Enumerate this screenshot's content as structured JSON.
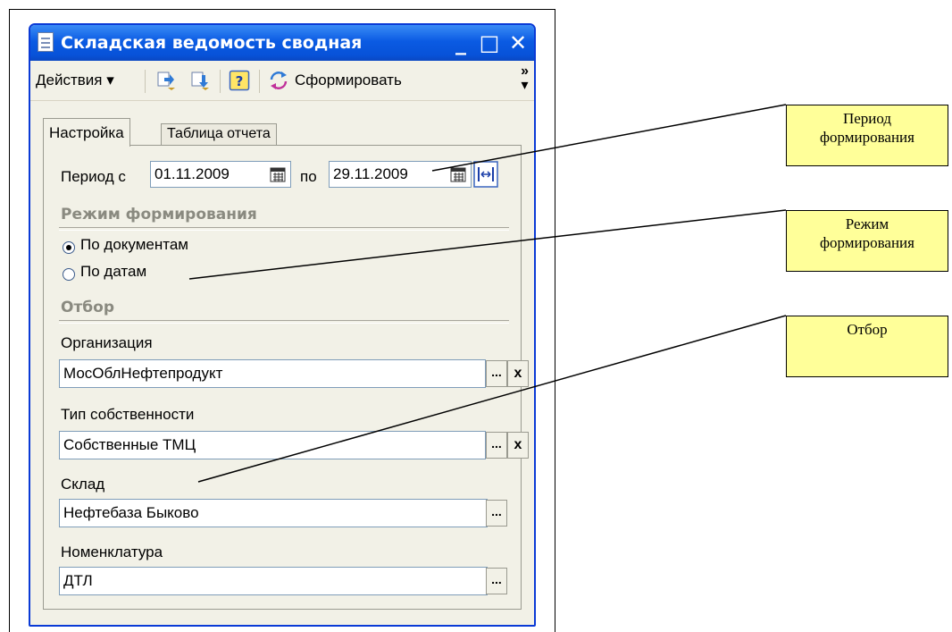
{
  "window": {
    "title": "Складская ведомость сводная",
    "controls": [
      "_",
      "□",
      "✕"
    ]
  },
  "toolbar": {
    "actions_label": "Действия ▾",
    "generate_label": "Сформировать",
    "more": "»"
  },
  "tabs": [
    {
      "label": "Настройка",
      "active": true
    },
    {
      "label": "Таблица отчета",
      "active": false
    }
  ],
  "period": {
    "from_label": "Период с",
    "from_value": "01.11.2009",
    "to_label": "по",
    "to_value": "29.11.2009"
  },
  "mode": {
    "title": "Режим формирования",
    "options": [
      {
        "label": "По документам",
        "selected": true
      },
      {
        "label": "По датам",
        "selected": false
      }
    ]
  },
  "filter": {
    "title": "Отбор",
    "fields": [
      {
        "label": "Организация",
        "value": "МосОблНефтепродукт",
        "buttons": [
          "...",
          "x"
        ]
      },
      {
        "label": "Тип собственности",
        "value": "Собственные ТМЦ",
        "buttons": [
          "...",
          "x"
        ]
      },
      {
        "label": "Склад",
        "value": "Нефтебаза Быково",
        "buttons": [
          "..."
        ]
      },
      {
        "label": "Номенклатура",
        "value": "ДТЛ",
        "buttons": [
          "..."
        ]
      }
    ]
  },
  "callouts": [
    {
      "line1": "Период",
      "line2": "формирования"
    },
    {
      "line1": "Режим",
      "line2": "формирования"
    },
    {
      "line1": "Отбор",
      "line2": ""
    }
  ],
  "colors": {
    "title_bar": "#0B5BE3",
    "window_bg": "#F2F1E7",
    "callout_bg": "#FFFF99",
    "border": "#0A3AD6"
  }
}
